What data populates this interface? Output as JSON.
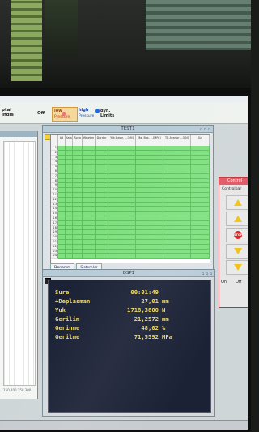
{
  "toolbar": {
    "left_label_1": "ptal",
    "left_label_2": "indis",
    "off_label": "Off",
    "low_label": "low",
    "low_sub": "Pressure",
    "high_label": "high",
    "high_sub": "Pressure",
    "dyn_label": "dyn.",
    "dyn_sub": "Limits"
  },
  "test_window": {
    "title": "TEST1",
    "columns": [
      "",
      "Ad",
      "Kafa",
      "Zorla",
      "Yönetim",
      "Durdur",
      "Yük.Basın. ...[kN]",
      "Ma. Bas. ...[MPa]",
      "TB Ayarlar ...[kN]",
      "Sv"
    ],
    "row_numbers": [
      "1",
      "2",
      "3",
      "4",
      "5",
      "6",
      "7",
      "8",
      "9",
      "10",
      "11",
      "12",
      "13",
      "14",
      "15",
      "16",
      "17",
      "18",
      "19",
      "20",
      "21",
      "22",
      "23",
      "24"
    ],
    "tabs": [
      "Donanım",
      "Sistemler"
    ]
  },
  "dsp_window": {
    "title": "DSP1",
    "rows": [
      {
        "label": "Sure",
        "value": "00:01:49",
        "unit": ""
      },
      {
        "label": "+Deplasman",
        "value": "27,01",
        "unit": "mm"
      },
      {
        "label": "Yuk",
        "value": "1718,3800",
        "unit": "N"
      },
      {
        "label": "Gerilim",
        "value": "21,2572",
        "unit": "mm"
      },
      {
        "label": "Gerinme",
        "value": "48,02",
        "unit": "%"
      },
      {
        "label": "Gerilme",
        "value": "71,5592",
        "unit": "MPa"
      }
    ]
  },
  "control_panel": {
    "title": "Control",
    "subtitle": "Controlbar",
    "stop_label": "STOP",
    "on_label": "On",
    "off_label": "Off"
  },
  "left_panel": {
    "axis_labels": "150 200 250 300"
  },
  "colors": {
    "grid_green": "#7fe07f",
    "dsp_background": "#1c2236",
    "dsp_text": "#f0d860",
    "stop_red": "#d92020",
    "arrow_yellow": "#f1c21a"
  }
}
